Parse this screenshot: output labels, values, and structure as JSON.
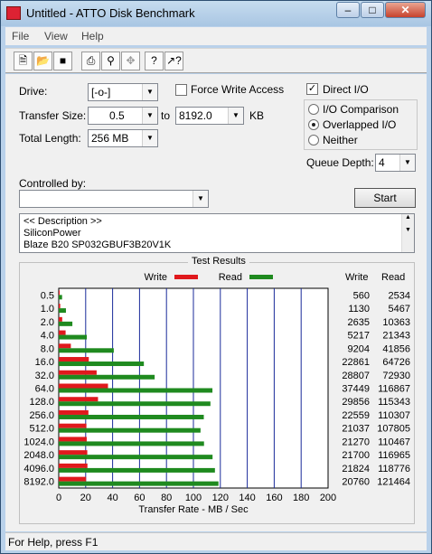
{
  "window": {
    "title": "Untitled - ATTO Disk Benchmark",
    "controls": {
      "minimize": "–",
      "maximize": "□",
      "close": "✕"
    }
  },
  "menu": [
    "File",
    "View",
    "Help"
  ],
  "toolbar": [
    "new-file-icon",
    "open-folder-icon",
    "save-icon",
    "print-icon",
    "print-preview-icon",
    "move-icon",
    "help-icon",
    "context-help-icon"
  ],
  "form": {
    "drive_label": "Drive:",
    "drive_value": "[-o-]",
    "transfer_size_label": "Transfer Size:",
    "transfer_from": "0.5",
    "to_label": "to",
    "transfer_to": "8192.0",
    "kb_label": "KB",
    "total_length_label": "Total Length:",
    "total_length_value": "256 MB",
    "force_write_label": "Force Write Access",
    "force_write_checked": false,
    "direct_io_label": "Direct I/O",
    "direct_io_checked": true,
    "io_comparison_label": "I/O Comparison",
    "overlapped_io_label": "Overlapped I/O",
    "neither_label": "Neither",
    "selected_io_mode": "Overlapped I/O",
    "queue_depth_label": "Queue Depth:",
    "queue_depth_value": "4",
    "controlled_by_label": "Controlled by:",
    "controlled_by_value": "",
    "start_label": "Start"
  },
  "description": {
    "lines": [
      "<< Description >>",
      "SiliconPower",
      "Blaze B20  SP032GBUF3B20V1K"
    ]
  },
  "results": {
    "title": "Test Results",
    "write_col": "Write",
    "read_col": "Read"
  },
  "chart_data": {
    "type": "bar",
    "orientation": "horizontal",
    "title": "Test Results",
    "xlabel": "Transfer Rate - MB / Sec",
    "xlim": [
      0,
      200
    ],
    "xticks": [
      0,
      20,
      40,
      60,
      80,
      100,
      120,
      140,
      160,
      180,
      200
    ],
    "categories": [
      "0.5",
      "1.0",
      "2.0",
      "4.0",
      "8.0",
      "16.0",
      "32.0",
      "64.0",
      "128.0",
      "256.0",
      "512.0",
      "1024.0",
      "2048.0",
      "4096.0",
      "8192.0"
    ],
    "series": [
      {
        "name": "Write",
        "color": "#e0191d",
        "values": [
          560,
          1130,
          2635,
          5217,
          9204,
          22861,
          28807,
          37449,
          29856,
          22559,
          21037,
          21270,
          21700,
          21824,
          20760
        ]
      },
      {
        "name": "Read",
        "color": "#1f8a1f",
        "values": [
          2534,
          5467,
          10363,
          21343,
          41856,
          64726,
          72930,
          116867,
          115343,
          110307,
          107805,
          110467,
          116965,
          118776,
          121464
        ]
      }
    ],
    "grid": true,
    "legend": "top"
  },
  "status": {
    "text": "For Help, press F1"
  }
}
